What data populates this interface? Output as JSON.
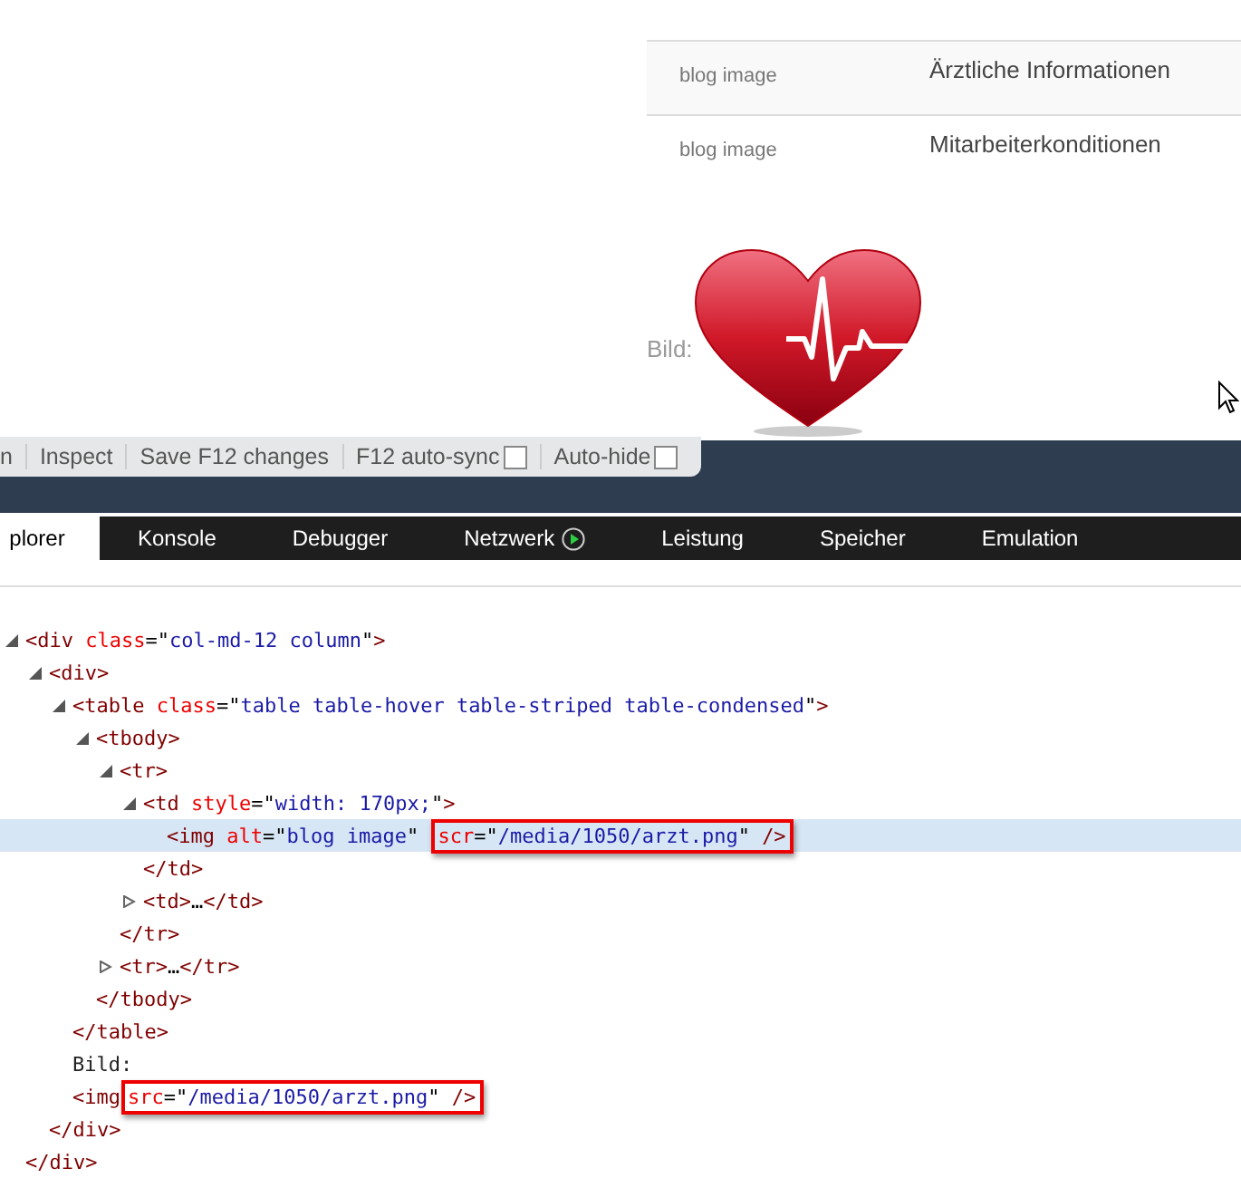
{
  "page": {
    "table": {
      "rows": [
        {
          "image_alt": "blog image",
          "title": "Ärztliche Informationen",
          "striped": true
        },
        {
          "image_alt": "blog image",
          "title": "Mitarbeiterkonditionen",
          "striped": false
        }
      ]
    },
    "image_label": "Bild:"
  },
  "toolbar": {
    "items": [
      {
        "label": "n",
        "kind": "text"
      },
      {
        "label": "Inspect",
        "kind": "text"
      },
      {
        "label": "Save F12 changes",
        "kind": "text"
      },
      {
        "label": "F12 auto-sync",
        "kind": "checkbox",
        "checked": false
      },
      {
        "label": "Auto-hide",
        "kind": "checkbox",
        "checked": false
      }
    ]
  },
  "tabs": [
    {
      "label": "plorer",
      "selected": true
    },
    {
      "label": "Konsole",
      "selected": false
    },
    {
      "label": "Debugger",
      "selected": false
    },
    {
      "label": "Netzwerk",
      "selected": false,
      "running": true
    },
    {
      "label": "Leistung",
      "selected": false
    },
    {
      "label": "Speicher",
      "selected": false
    },
    {
      "label": "Emulation",
      "selected": false
    }
  ],
  "dom_tree": [
    {
      "selected": false,
      "expanded": true,
      "tokens": [
        {
          "kind": "tag",
          "text": "<div "
        },
        {
          "kind": "attr",
          "text": "class"
        },
        {
          "kind": "punct",
          "text": "=\""
        },
        {
          "kind": "value",
          "text": "col-md-12 column"
        },
        {
          "kind": "punct",
          "text": "\""
        },
        {
          "kind": "tag",
          "text": ">"
        }
      ],
      "children": [
        {
          "selected": false,
          "expanded": true,
          "tokens": [
            {
              "kind": "tag",
              "text": "<div>"
            }
          ],
          "children": [
            {
              "selected": false,
              "expanded": true,
              "tokens": [
                {
                  "kind": "tag",
                  "text": "<table "
                },
                {
                  "kind": "attr",
                  "text": "class"
                },
                {
                  "kind": "punct",
                  "text": "=\""
                },
                {
                  "kind": "value",
                  "text": "table table-hover table-striped table-condensed"
                },
                {
                  "kind": "punct",
                  "text": "\""
                },
                {
                  "kind": "tag",
                  "text": ">"
                }
              ],
              "children": [
                {
                  "selected": false,
                  "expanded": true,
                  "tokens": [
                    {
                      "kind": "tag",
                      "text": "<tbody>"
                    }
                  ],
                  "children": [
                    {
                      "selected": false,
                      "expanded": true,
                      "tokens": [
                        {
                          "kind": "tag",
                          "text": "<tr>"
                        }
                      ],
                      "children": [
                        {
                          "selected": false,
                          "expanded": true,
                          "tokens": [
                            {
                              "kind": "tag",
                              "text": "<td "
                            },
                            {
                              "kind": "attr",
                              "text": "style"
                            },
                            {
                              "kind": "punct",
                              "text": "=\""
                            },
                            {
                              "kind": "value",
                              "text": "width: 170px;"
                            },
                            {
                              "kind": "punct",
                              "text": "\""
                            },
                            {
                              "kind": "tag",
                              "text": ">"
                            }
                          ],
                          "children": [
                            {
                              "selected": true,
                              "tokens": [
                                {
                                  "kind": "tag",
                                  "text": "<img "
                                },
                                {
                                  "kind": "attr",
                                  "text": "alt"
                                },
                                {
                                  "kind": "punct",
                                  "text": "=\""
                                },
                                {
                                  "kind": "value",
                                  "text": "blog image"
                                },
                                {
                                  "kind": "punct",
                                  "text": "\" "
                                },
                                {
                                  "kind": "boxed",
                                  "tokens": [
                                    {
                                      "kind": "attr",
                                      "text": "scr"
                                    },
                                    {
                                      "kind": "punct",
                                      "text": "=\""
                                    },
                                    {
                                      "kind": "value",
                                      "text": "/media/1050/arzt.png"
                                    },
                                    {
                                      "kind": "punct",
                                      "text": "\" "
                                    },
                                    {
                                      "kind": "tag",
                                      "text": "/>"
                                    }
                                  ]
                                }
                              ]
                            }
                          ]
                        },
                        {
                          "selected": false,
                          "tokens": [
                            {
                              "kind": "tag",
                              "text": "</td>"
                            }
                          ]
                        },
                        {
                          "selected": false,
                          "expanded": false,
                          "tokens": [
                            {
                              "kind": "tag",
                              "text": "<td>"
                            },
                            {
                              "kind": "punct",
                              "text": "…"
                            },
                            {
                              "kind": "tag",
                              "text": "</td>"
                            }
                          ]
                        }
                      ]
                    },
                    {
                      "selected": false,
                      "tokens": [
                        {
                          "kind": "tag",
                          "text": "</tr>"
                        }
                      ]
                    },
                    {
                      "selected": false,
                      "expanded": false,
                      "tokens": [
                        {
                          "kind": "tag",
                          "text": "<tr>"
                        },
                        {
                          "kind": "punct",
                          "text": "…"
                        },
                        {
                          "kind": "tag",
                          "text": "</tr>"
                        }
                      ]
                    }
                  ]
                },
                {
                  "selected": false,
                  "tokens": [
                    {
                      "kind": "tag",
                      "text": "</tbody>"
                    }
                  ]
                }
              ]
            },
            {
              "selected": false,
              "tokens": [
                {
                  "kind": "tag",
                  "text": "</table>"
                }
              ]
            },
            {
              "selected": false,
              "tokens": [
                {
                  "kind": "text",
                  "text": "Bild:"
                }
              ]
            },
            {
              "selected": false,
              "tokens": [
                {
                  "kind": "tag",
                  "text": "<img"
                },
                {
                  "kind": "boxed",
                  "tokens": [
                    {
                      "kind": "attr",
                      "text": "src"
                    },
                    {
                      "kind": "punct",
                      "text": "=\""
                    },
                    {
                      "kind": "value",
                      "text": "/media/1050/arzt.png"
                    },
                    {
                      "kind": "punct",
                      "text": "\" "
                    },
                    {
                      "kind": "tag",
                      "text": "/>"
                    }
                  ]
                }
              ]
            }
          ]
        },
        {
          "selected": false,
          "tokens": [
            {
              "kind": "tag",
              "text": "</div>"
            }
          ]
        }
      ]
    },
    {
      "selected": false,
      "tokens": [
        {
          "kind": "tag",
          "text": "</div>"
        }
      ]
    }
  ]
}
